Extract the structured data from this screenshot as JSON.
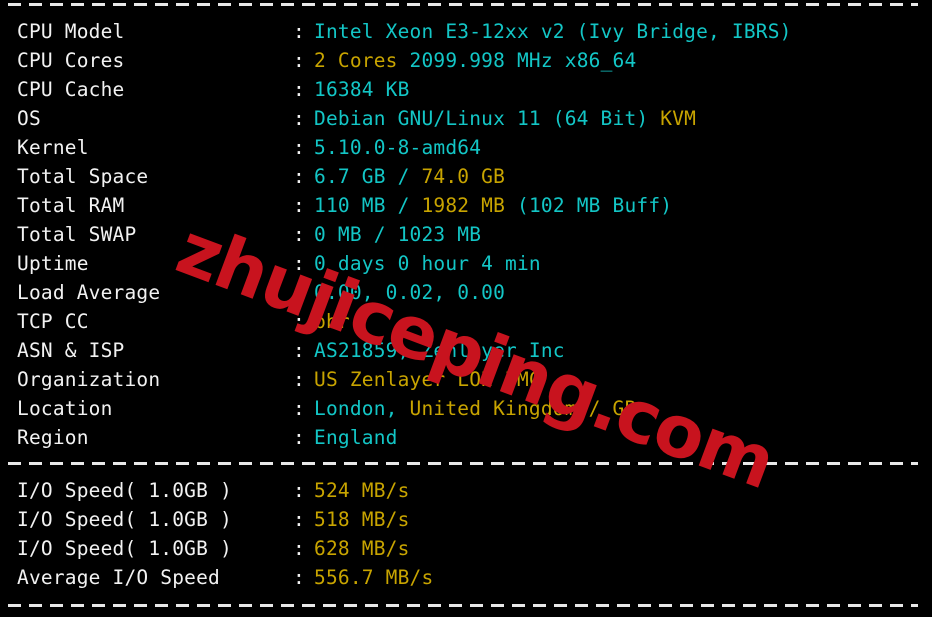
{
  "terminal": {
    "background_color": "#000000",
    "label_color": "#f2f2f2",
    "cyan_color": "#13c6c6",
    "yellow_color": "#c8a400",
    "separator": "-------------------------------------------------------",
    "colon": ":"
  },
  "watermark": {
    "text": "zhujiceping.com",
    "color": "#c8131e"
  },
  "sysinfo": {
    "rows": [
      {
        "label": "CPU Model",
        "segments": [
          {
            "text": "Intel Xeon E3-12xx v2 (Ivy Bridge, IBRS)",
            "color": "cyan"
          }
        ]
      },
      {
        "label": "CPU Cores",
        "segments": [
          {
            "text": "2 Cores",
            "color": "yellow"
          },
          {
            "text": " 2099.998 MHz x86_64",
            "color": "cyan"
          }
        ]
      },
      {
        "label": "CPU Cache",
        "segments": [
          {
            "text": "16384 KB",
            "color": "cyan"
          }
        ]
      },
      {
        "label": "OS",
        "segments": [
          {
            "text": "Debian GNU/Linux 11 (64 Bit) ",
            "color": "cyan"
          },
          {
            "text": "KVM",
            "color": "yellow"
          }
        ]
      },
      {
        "label": "Kernel",
        "segments": [
          {
            "text": "5.10.0-8-amd64",
            "color": "cyan"
          }
        ]
      },
      {
        "label": "Total Space",
        "segments": [
          {
            "text": "6.7 GB ",
            "color": "cyan"
          },
          {
            "text": "/ ",
            "color": "cyan"
          },
          {
            "text": "74.0 GB",
            "color": "yellow"
          }
        ]
      },
      {
        "label": "Total RAM",
        "segments": [
          {
            "text": "110 MB ",
            "color": "cyan"
          },
          {
            "text": "/ ",
            "color": "cyan"
          },
          {
            "text": "1982 MB",
            "color": "yellow"
          },
          {
            "text": " (102 MB Buff)",
            "color": "cyan"
          }
        ]
      },
      {
        "label": "Total SWAP",
        "segments": [
          {
            "text": "0 MB / 1023 MB",
            "color": "cyan"
          }
        ]
      },
      {
        "label": "Uptime",
        "segments": [
          {
            "text": "0 days 0 hour 4 min",
            "color": "cyan"
          }
        ]
      },
      {
        "label": "Load Average",
        "segments": [
          {
            "text": "0.00, 0.02, 0.00",
            "color": "cyan"
          }
        ]
      },
      {
        "label": "TCP CC",
        "segments": [
          {
            "text": "bbr",
            "color": "yellow"
          }
        ]
      },
      {
        "label": "ASN & ISP",
        "segments": [
          {
            "text": "AS21859, Zenlayer Inc",
            "color": "cyan"
          }
        ]
      },
      {
        "label": "Organization",
        "segments": [
          {
            "text": "US Zenlayer LON BMC",
            "color": "yellow"
          }
        ]
      },
      {
        "label": "Location",
        "segments": [
          {
            "text": "London, ",
            "color": "cyan"
          },
          {
            "text": "United Kingdom / GB",
            "color": "yellow"
          }
        ]
      },
      {
        "label": "Region",
        "segments": [
          {
            "text": "England",
            "color": "cyan"
          }
        ]
      }
    ]
  },
  "iospeed": {
    "rows": [
      {
        "label": "I/O Speed( 1.0GB )",
        "segments": [
          {
            "text": "524 MB/s",
            "color": "yellow"
          }
        ]
      },
      {
        "label": "I/O Speed( 1.0GB )",
        "segments": [
          {
            "text": "518 MB/s",
            "color": "yellow"
          }
        ]
      },
      {
        "label": "I/O Speed( 1.0GB )",
        "segments": [
          {
            "text": "628 MB/s",
            "color": "yellow"
          }
        ]
      },
      {
        "label": "Average I/O Speed",
        "segments": [
          {
            "text": "556.7 MB/s",
            "color": "yellow"
          }
        ]
      }
    ]
  }
}
